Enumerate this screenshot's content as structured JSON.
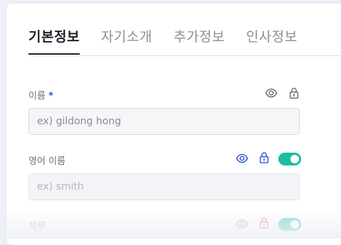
{
  "tabs": [
    {
      "label": "기본정보",
      "active": true
    },
    {
      "label": "자기소개",
      "active": false
    },
    {
      "label": "추가정보",
      "active": false
    },
    {
      "label": "인사정보",
      "active": false
    }
  ],
  "fields": {
    "name": {
      "label": "이름",
      "required_mark": "*",
      "placeholder": "ex) gildong hong",
      "icons": [
        "eye-icon",
        "lock-icon"
      ]
    },
    "english_name": {
      "label": "영어 이름",
      "placeholder": "ex) smith",
      "icons": [
        "eye-icon",
        "lock-icon"
      ],
      "toggle_on": true
    },
    "job": {
      "label": "직무",
      "icons": [
        "eye-icon",
        "lock-icon"
      ],
      "toggle_on": true
    }
  },
  "colors": {
    "accent_blue": "#2c55d6",
    "toggle_green": "#1ebba0",
    "lock_red": "#e0607a"
  }
}
